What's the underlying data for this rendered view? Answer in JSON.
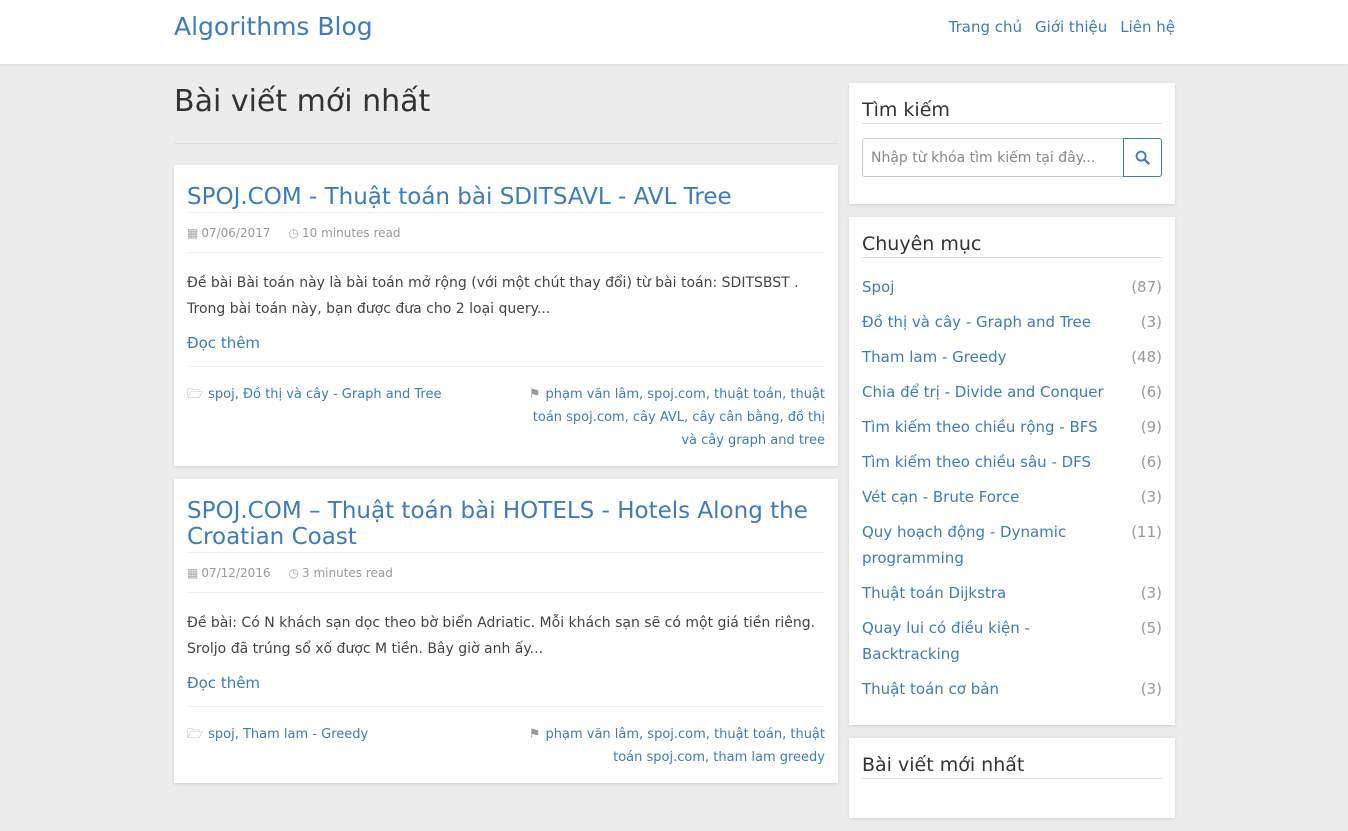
{
  "nav": {
    "brand": "Algorithms Blog",
    "links": [
      "Trang chủ",
      "Giới thiệu",
      "Liên hệ"
    ]
  },
  "main": {
    "title": "Bài viết mới nhất",
    "posts": [
      {
        "title": "SPOJ.COM - Thuật toán bài SDITSAVL - AVL Tree",
        "date": "07/06/2017",
        "read_time": "10 minutes read",
        "excerpt": "Đề bài Bài toán này là bài toán mở rộng (với một chút thay đổi) từ bài toán:  SDITSBST . Trong bài toán này, bạn được đưa cho 2 loại query...",
        "read_more": "Đọc thêm",
        "categories": "spoj, Đồ thị và cây - Graph and Tree",
        "tags": "phạm văn lâm, spoj.com, thuật toán, thuật toán spoj.com, cây AVL, cây cân bằng, đồ thị và cây graph and tree"
      },
      {
        "title": "SPOJ.COM – Thuật toán bài HOTELS - Hotels Along the Croatian Coast",
        "date": "07/12/2016",
        "read_time": "3 minutes read",
        "excerpt": "Đề bài: Có N khách sạn dọc theo bờ biển Adriatic. Mỗi khách sạn sẽ có một giá tiền riêng. Sroljo đã trúng sổ xố được M tiền. Bây giờ anh ấy...",
        "read_more": "Đọc thêm",
        "categories": "spoj, Tham lam - Greedy",
        "tags": "phạm văn lâm, spoj.com, thuật toán, thuật toán spoj.com, tham lam greedy"
      }
    ]
  },
  "sidebar": {
    "search": {
      "title": "Tìm kiếm",
      "placeholder": "Nhập từ khóa tìm kiếm tại đây...",
      "icon": "search-icon"
    },
    "categories": {
      "title": "Chuyên mục",
      "items": [
        {
          "name": "Spoj",
          "count": "(87)"
        },
        {
          "name": "Đồ thị và cây - Graph and Tree",
          "count": "(3)"
        },
        {
          "name": "Tham lam - Greedy",
          "count": "(48)"
        },
        {
          "name": "Chia để trị - Divide and Conquer",
          "count": "(6)"
        },
        {
          "name": "Tìm kiếm theo chiều rộng - BFS",
          "count": "(9)"
        },
        {
          "name": "Tìm kiếm theo chiều sâu - DFS",
          "count": "(6)"
        },
        {
          "name": "Vét cạn - Brute Force",
          "count": "(3)"
        },
        {
          "name": "Quy hoạch động - Dynamic programming",
          "count": "(11)"
        },
        {
          "name": "Thuật toán Dijkstra",
          "count": "(3)"
        },
        {
          "name": "Quay lui có điều kiện - Backtracking",
          "count": "(5)"
        },
        {
          "name": "Thuật toán cơ bản",
          "count": "(3)"
        }
      ]
    },
    "recent": {
      "title": "Bài viết mới nhất"
    }
  }
}
